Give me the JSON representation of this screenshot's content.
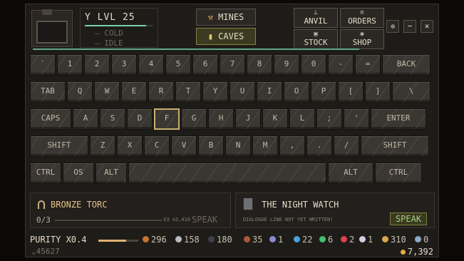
{
  "header": {
    "level_label": "Y LVL 25",
    "level_progress": 0.9,
    "status_line1": "— COLD",
    "status_line2": "— IDLE",
    "mines_label": "MINES",
    "caves_label": "CAVES",
    "anvil_label": "ANVIL",
    "orders_label": "ORDERS",
    "stock_label": "STOCK",
    "shop_label": "SHOP",
    "settings_icon": "gear-icon",
    "minimize_icon": "minus-icon",
    "close_icon": "close-icon"
  },
  "keyboard": {
    "row1": [
      "`",
      "1",
      "2",
      "3",
      "4",
      "5",
      "6",
      "7",
      "8",
      "9",
      "0",
      "-",
      "=",
      "BACK"
    ],
    "row2": [
      "TAB",
      "Q",
      "W",
      "E",
      "R",
      "T",
      "Y",
      "U",
      "I",
      "O",
      "P",
      "[",
      "]",
      "\\"
    ],
    "row3": [
      "CAPS",
      "A",
      "S",
      "D",
      "F",
      "G",
      "H",
      "J",
      "K",
      "L",
      ";",
      "'",
      "ENTER"
    ],
    "row4": [
      "SHIFT",
      "Z",
      "X",
      "C",
      "V",
      "B",
      "N",
      "M",
      ",",
      ".",
      "/",
      "SHIFT"
    ],
    "row5": [
      "CTRL",
      "OS",
      "ALT",
      "",
      "ALT",
      "CTRL"
    ],
    "highlighted": "F"
  },
  "quest": {
    "item_name": "BRONZE TORC",
    "item_icon": "torc-icon",
    "count": "0/3",
    "multiplier": "X3 ⊙2,410",
    "speak_label": "SPEAK"
  },
  "dialogue": {
    "npc_name": "THE NIGHT WATCH",
    "npc_icon": "guard-icon",
    "line": "DIALOGUE LINE NOT YET WRITTEN!",
    "speak_label": "SPEAK"
  },
  "footer": {
    "purity_label": "PURITY X0.4",
    "purity_progress": 0.7,
    "sub_value": "⌄45627",
    "resources": [
      {
        "value": "296",
        "color": "#c8732e"
      },
      {
        "value": "158",
        "color": "#b9bcc0"
      },
      {
        "value": "180",
        "color": "#3e4248"
      },
      {
        "value": "35",
        "color": "#b0563a"
      },
      {
        "value": "1",
        "color": "#8a8ad0"
      },
      {
        "value": "22",
        "color": "#4aa0e0"
      },
      {
        "value": "6",
        "color": "#40c070"
      },
      {
        "value": "2",
        "color": "#e04050"
      },
      {
        "value": "1",
        "color": "#d0d0e0"
      },
      {
        "value": "310",
        "color": "#d8a848"
      },
      {
        "value": "0",
        "color": "#90a8c8"
      }
    ],
    "gold": "7,392"
  }
}
